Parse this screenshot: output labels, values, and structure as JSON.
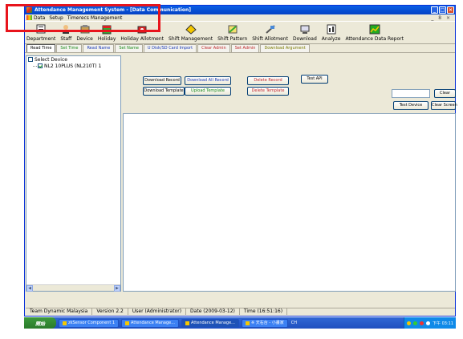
{
  "window": {
    "title": "Attendance Management System - [Data Communication]",
    "controls": [
      "_",
      "□",
      "×"
    ]
  },
  "menu": {
    "items": [
      "Data",
      "Setup",
      "Timerecs Management"
    ],
    "mdi_controls": "_ 8 ×"
  },
  "toolbar": {
    "items": [
      {
        "label": "Department",
        "icon": "department-icon"
      },
      {
        "label": "Staff",
        "icon": "staff-icon"
      },
      {
        "label": "Device",
        "icon": "device-icon"
      },
      {
        "label": "Holiday",
        "icon": "holiday-icon"
      },
      {
        "label": "Holiday Allotment",
        "icon": "holiday-allotment-icon"
      },
      {
        "label": "Shift Management",
        "icon": "shift-management-icon"
      },
      {
        "label": "Shift Pattern",
        "icon": "shift-pattern-icon"
      },
      {
        "label": "Shift Allotment",
        "icon": "shift-allotment-icon"
      },
      {
        "label": "Download",
        "icon": "download-icon"
      },
      {
        "label": "Analyze",
        "icon": "analyze-icon"
      },
      {
        "label": "Attendance Data Report",
        "icon": "report-icon"
      }
    ]
  },
  "tabs": {
    "items": [
      {
        "label": "Read Time",
        "color": "#000000"
      },
      {
        "label": "Set Time",
        "color": "#1a8a1a"
      },
      {
        "label": "Read Name",
        "color": "#1a3ab8"
      },
      {
        "label": "Set Name",
        "color": "#1a8a1a"
      },
      {
        "label": "U Disk/SD Card Import",
        "color": "#1a3ab8"
      },
      {
        "label": "Clear Admin",
        "color": "#c0282c"
      },
      {
        "label": "Set Admin",
        "color": "#c0282c"
      },
      {
        "label": "Download Argument",
        "color": "#7a7a00"
      }
    ]
  },
  "tree": {
    "select_all": "Select Device",
    "device": "NL2 10PLUS   (NL210T)  1"
  },
  "buttons": {
    "download_record": "Download Record",
    "download_all_record": "Download All Record",
    "delete_record": "Delete Record",
    "test_api": "Test API",
    "download_template": "Download Template",
    "upload_template": "Upload Template",
    "delete_template": "Delete Template",
    "clear": "Clear",
    "test_device": "Test Device",
    "clear_screen": "Clear Screen"
  },
  "statusbar": {
    "company": "Team Dynamic Malaysia",
    "version": "Version 2.2",
    "user": "User (Administrator)",
    "date": "Date (2009-03-12)",
    "time": "Time (16:51:16)"
  },
  "taskbar": {
    "start": "開始",
    "tasks": [
      "zkSensor Component 1",
      "Attendance Manage...",
      "Attendance Manage...",
      "※ 天右台 - 小畫家"
    ],
    "lang": "CH",
    "clock": "下午 03:11"
  }
}
